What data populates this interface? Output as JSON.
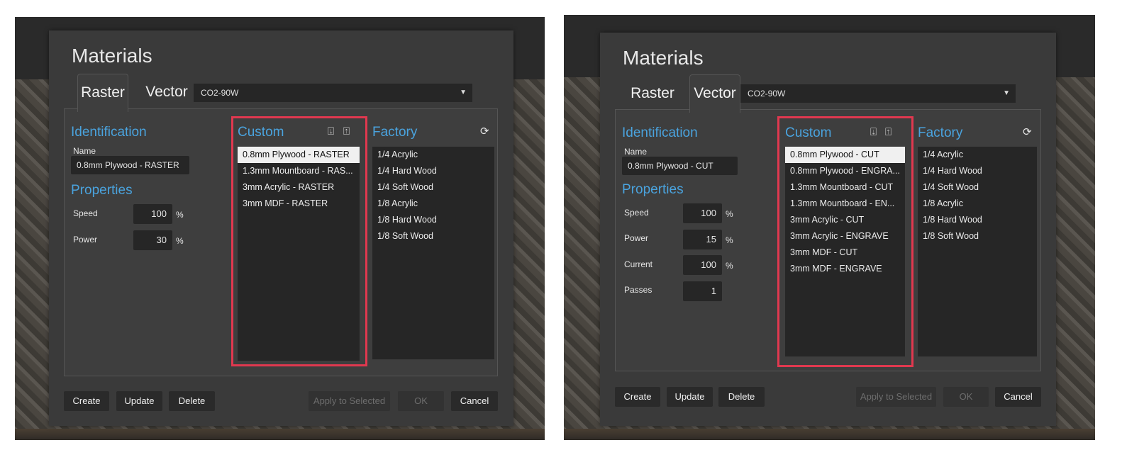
{
  "left": {
    "title": "Materials",
    "tabs": {
      "raster": "Raster",
      "vector": "Vector"
    },
    "machine": "CO2-90W",
    "identification": {
      "heading": "Identification",
      "name_label": "Name",
      "name_value": "0.8mm Plywood - RASTER"
    },
    "properties": {
      "heading": "Properties",
      "speed_label": "Speed",
      "speed_value": "100",
      "power_label": "Power",
      "power_value": "30",
      "unit": "%"
    },
    "custom": {
      "heading": "Custom",
      "items": [
        "0.8mm Plywood - RASTER",
        "1.3mm Mountboard - RAS...",
        "3mm Acrylic - RASTER",
        "3mm MDF - RASTER"
      ]
    },
    "factory": {
      "heading": "Factory",
      "items": [
        "1/4 Acrylic",
        "1/4 Hard Wood",
        "1/4 Soft Wood",
        "1/8 Acrylic",
        "1/8 Hard Wood",
        "1/8 Soft Wood"
      ]
    },
    "buttons": {
      "create": "Create",
      "update": "Update",
      "delete": "Delete",
      "apply": "Apply to Selected",
      "ok": "OK",
      "cancel": "Cancel"
    }
  },
  "right": {
    "title": "Materials",
    "tabs": {
      "raster": "Raster",
      "vector": "Vector"
    },
    "machine": "CO2-90W",
    "identification": {
      "heading": "Identification",
      "name_label": "Name",
      "name_value": "0.8mm Plywood - CUT"
    },
    "properties": {
      "heading": "Properties",
      "speed_label": "Speed",
      "speed_value": "100",
      "power_label": "Power",
      "power_value": "15",
      "current_label": "Current",
      "current_value": "100",
      "passes_label": "Passes",
      "passes_value": "1",
      "unit": "%"
    },
    "custom": {
      "heading": "Custom",
      "items": [
        "0.8mm Plywood - CUT",
        "0.8mm Plywood - ENGRA...",
        "1.3mm Mountboard - CUT",
        "1.3mm Mountboard - EN...",
        "3mm Acrylic - CUT",
        "3mm Acrylic - ENGRAVE",
        "3mm MDF - CUT",
        "3mm MDF - ENGRAVE"
      ]
    },
    "factory": {
      "heading": "Factory",
      "items": [
        "1/4 Acrylic",
        "1/4 Hard Wood",
        "1/4 Soft Wood",
        "1/8 Acrylic",
        "1/8 Hard Wood",
        "1/8 Soft Wood"
      ]
    },
    "buttons": {
      "create": "Create",
      "update": "Update",
      "delete": "Delete",
      "apply": "Apply to Selected",
      "ok": "OK",
      "cancel": "Cancel"
    }
  },
  "icons": {
    "export": "export-icon",
    "import": "import-icon",
    "refresh": "refresh-icon",
    "dropdown": "chevron-down-icon"
  },
  "colors": {
    "accent_heading": "#4aa3de",
    "highlight_box": "#e0384f",
    "dialog_bg": "#3a3a3a",
    "list_bg": "#262626"
  }
}
